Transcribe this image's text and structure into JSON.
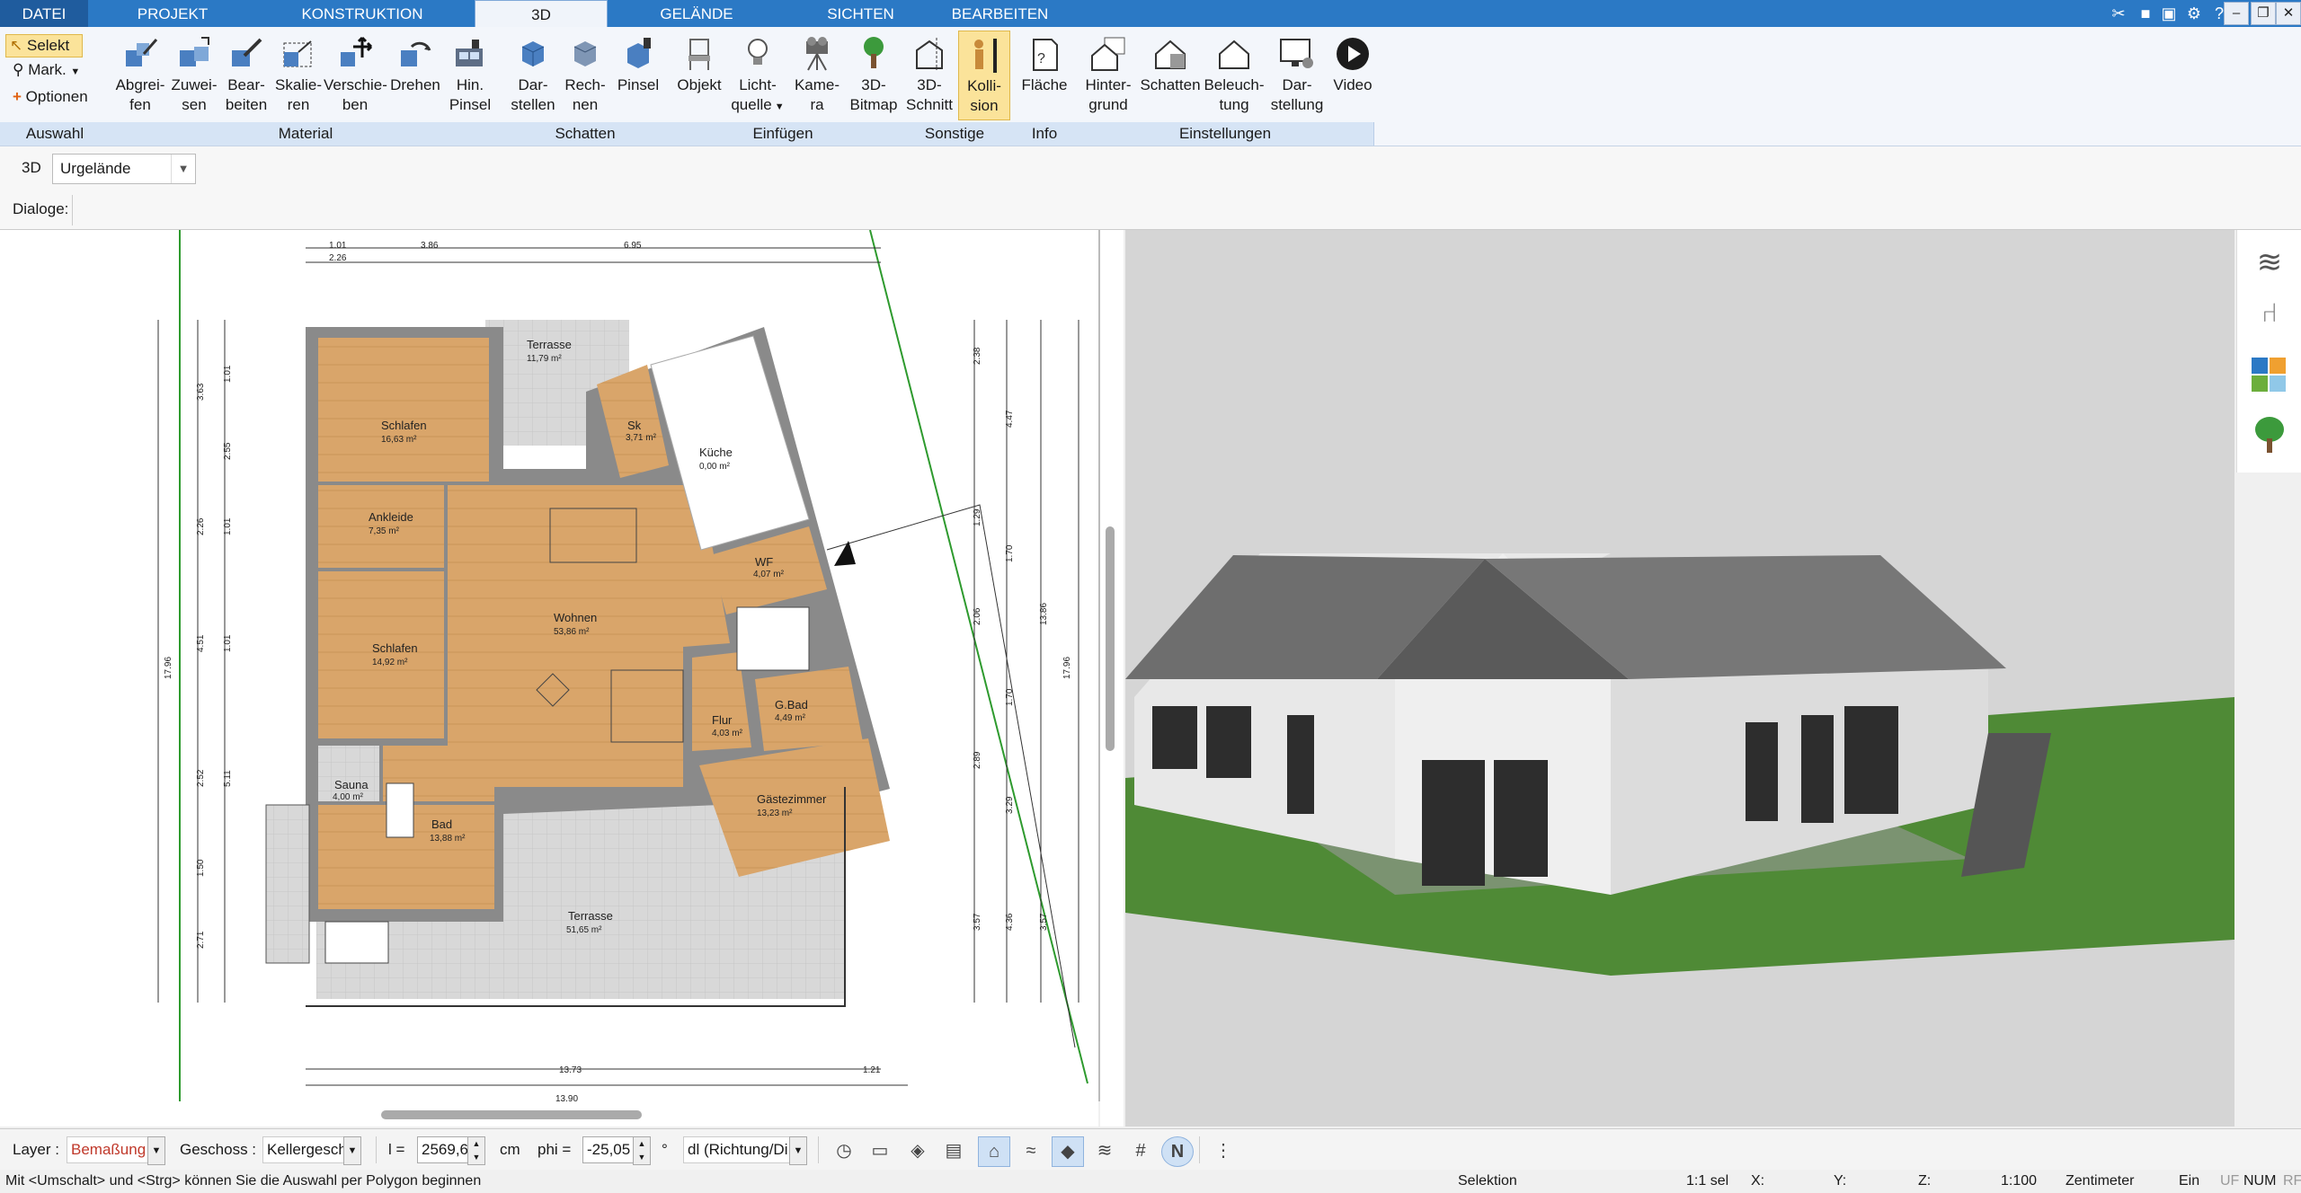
{
  "tabs": [
    {
      "label": "DATEI"
    },
    {
      "label": "PROJEKT"
    },
    {
      "label": "KONSTRUKTION"
    },
    {
      "label": "3D"
    },
    {
      "label": "GELÄNDE"
    },
    {
      "label": "SICHTEN"
    },
    {
      "label": "BEARBEITEN"
    }
  ],
  "selection": {
    "select_label": "Selekt",
    "mark_label": "Mark.",
    "options_label": "Optionen",
    "group_label": "Auswahl"
  },
  "ribbon": {
    "material": {
      "group_label": "Material",
      "buttons": [
        {
          "l1": "Abgrei-",
          "l2": "fen"
        },
        {
          "l1": "Zuwei-",
          "l2": "sen"
        },
        {
          "l1": "Bear-",
          "l2": "beiten"
        },
        {
          "l1": "Skalie-",
          "l2": "ren"
        },
        {
          "l1": "Verschie-",
          "l2": "ben"
        },
        {
          "l1": "Drehen",
          "l2": ""
        },
        {
          "l1": "Hin.",
          "l2": "Pinsel"
        }
      ]
    },
    "schatten": {
      "group_label": "Schatten",
      "buttons": [
        {
          "l1": "Dar-",
          "l2": "stellen"
        },
        {
          "l1": "Rech-",
          "l2": "nen"
        },
        {
          "l1": "Pinsel",
          "l2": ""
        }
      ]
    },
    "einfuegen": {
      "group_label": "Einfügen",
      "buttons": [
        {
          "l1": "Objekt",
          "l2": ""
        },
        {
          "l1": "Licht-",
          "l2": "quelle"
        },
        {
          "l1": "Kame-",
          "l2": "ra"
        },
        {
          "l1": "3D-",
          "l2": "Bitmap"
        }
      ]
    },
    "sonstige": {
      "group_label": "Sonstige",
      "buttons": [
        {
          "l1": "3D-",
          "l2": "Schnitt"
        },
        {
          "l1": "Kolli-",
          "l2": "sion"
        }
      ]
    },
    "info": {
      "group_label": "Info",
      "buttons": [
        {
          "l1": "Fläche",
          "l2": ""
        }
      ]
    },
    "einstellungen": {
      "group_label": "Einstellungen",
      "buttons": [
        {
          "l1": "Hinter-",
          "l2": "grund"
        },
        {
          "l1": "Schatten",
          "l2": ""
        },
        {
          "l1": "Beleuch-",
          "l2": "tung"
        },
        {
          "l1": "Dar-",
          "l2": "stellung"
        },
        {
          "l1": "Video",
          "l2": ""
        }
      ]
    }
  },
  "bar3d": {
    "label": "3D",
    "dropdown_value": "Urgelände"
  },
  "dialog_bar": {
    "label": "Dialoge:"
  },
  "plan": {
    "rooms": [
      {
        "name": "Terrasse",
        "area": "11,79 m²"
      },
      {
        "name": "Schlafen",
        "area": "16,63 m²"
      },
      {
        "name": "Sk",
        "area": "3,71 m²"
      },
      {
        "name": "Küche",
        "area": "0,00 m²"
      },
      {
        "name": "Ankleide",
        "area": "7,35 m²"
      },
      {
        "name": "Wohnen",
        "area": "53,86 m²"
      },
      {
        "name": "WF",
        "area": "4,07 m²"
      },
      {
        "name": "Schlafen",
        "area": "14,92 m²"
      },
      {
        "name": "Flur",
        "area": "4,03 m²"
      },
      {
        "name": "G.Bad",
        "area": "4,49 m²"
      },
      {
        "name": "Sauna",
        "area": "4,00 m²"
      },
      {
        "name": "Bad",
        "area": "13,88 m²"
      },
      {
        "name": "Gästezimmer",
        "area": "13,23 m²"
      },
      {
        "name": "Terrasse",
        "area": "51,65 m²"
      }
    ],
    "dims_top": [
      "1.01",
      "2.26",
      "3.86",
      "6.95"
    ],
    "dims_left": [
      "3.63",
      "1.01",
      "2.55",
      "2.26",
      "1.01",
      "4.51",
      "1.01",
      "2.52",
      "5.11",
      "1.50",
      "2.71",
      "17.96"
    ],
    "dims_right": [
      "2.38",
      "4.47",
      "1.29",
      "1.70",
      "2.06",
      "13.86",
      "1.70",
      "2.89",
      "3.29",
      "3.57",
      "4.36",
      "3.57",
      "17.96"
    ],
    "dims_bottom": [
      "13.73",
      "13.90",
      "1.21"
    ]
  },
  "bottom": {
    "layer_label": "Layer :",
    "layer_value": "Bemaßung",
    "geschoss_label": "Geschoss :",
    "geschoss_value": "Kellergesch",
    "l_label": "l =",
    "l_value": "2569,6",
    "l_unit": "cm",
    "phi_label": "phi =",
    "phi_value": "-25,05",
    "phi_unit": "°",
    "dl_value": "dl (Richtung/Di"
  },
  "status": {
    "hint": "Mit <Umschalt> und <Strg> können Sie die Auswahl per Polygon beginnen",
    "mode": "Selektion",
    "sel": "1:1 sel",
    "x": "X:",
    "y": "Y:",
    "z": "Z:",
    "scale": "1:100",
    "unit": "Zentimeter",
    "ein": "Ein",
    "uf": "UF",
    "num": "NUM",
    "rf": "RF"
  },
  "colors": {
    "tab_bar": "#2b79c5",
    "floor": "#d9a56a",
    "wall": "#8a8a8a",
    "grass": "#4f8a36",
    "roof": "#6e6e6e",
    "highlight": "#fbe39a",
    "layer_value": "#c0392b"
  }
}
